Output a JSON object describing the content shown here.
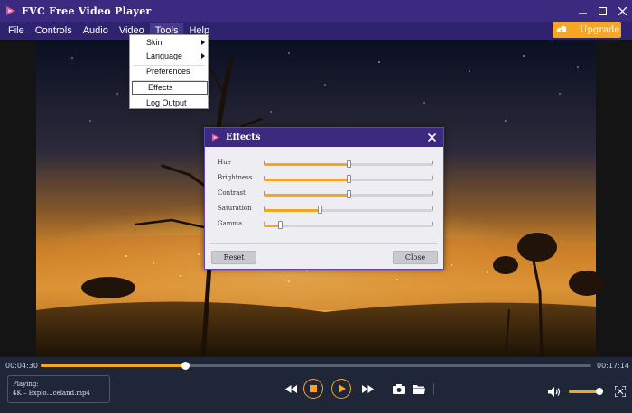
{
  "app": {
    "title": "FVC Free Video Player"
  },
  "menubar": {
    "items": [
      "File",
      "Controls",
      "Audio",
      "Video",
      "Tools",
      "Help"
    ],
    "active": "Tools"
  },
  "upgrade_label": "Upgrade",
  "tools_menu": {
    "items": [
      {
        "label": "Skin",
        "submenu": true
      },
      {
        "label": "Language",
        "submenu": true
      },
      {
        "label": "Preferences",
        "submenu": false
      },
      {
        "label": "Effects",
        "submenu": false,
        "selected": true
      },
      {
        "label": "Log Output",
        "submenu": false
      }
    ]
  },
  "effects_dialog": {
    "title": "Effects",
    "sliders": [
      {
        "label": "Hue",
        "value": 0.5
      },
      {
        "label": "Brightness",
        "value": 0.5
      },
      {
        "label": "Contrast",
        "value": 0.5
      },
      {
        "label": "Saturation",
        "value": 0.33
      },
      {
        "label": "Gamma",
        "value": 0.1
      }
    ],
    "reset_label": "Reset",
    "close_label": "Close"
  },
  "player": {
    "elapsed": "00:04:30",
    "total": "00:17:14",
    "progress": 0.263,
    "playing_label": "Playing:",
    "file_name": "4K – Explo…celand.mp4",
    "volume": 0.9
  },
  "colors": {
    "accent": "#f5a623",
    "titlebar": "#3b2a80",
    "menubar": "#2f2370",
    "panel": "#1e2638"
  },
  "icons": [
    "logo-icon",
    "minimize-icon",
    "maximize-icon",
    "close-icon",
    "upgrade-icon",
    "submenu-arrow-icon",
    "rewind-icon",
    "stop-icon",
    "play-icon",
    "forward-icon",
    "snapshot-icon",
    "folder-icon",
    "volume-icon",
    "fullscreen-icon"
  ]
}
